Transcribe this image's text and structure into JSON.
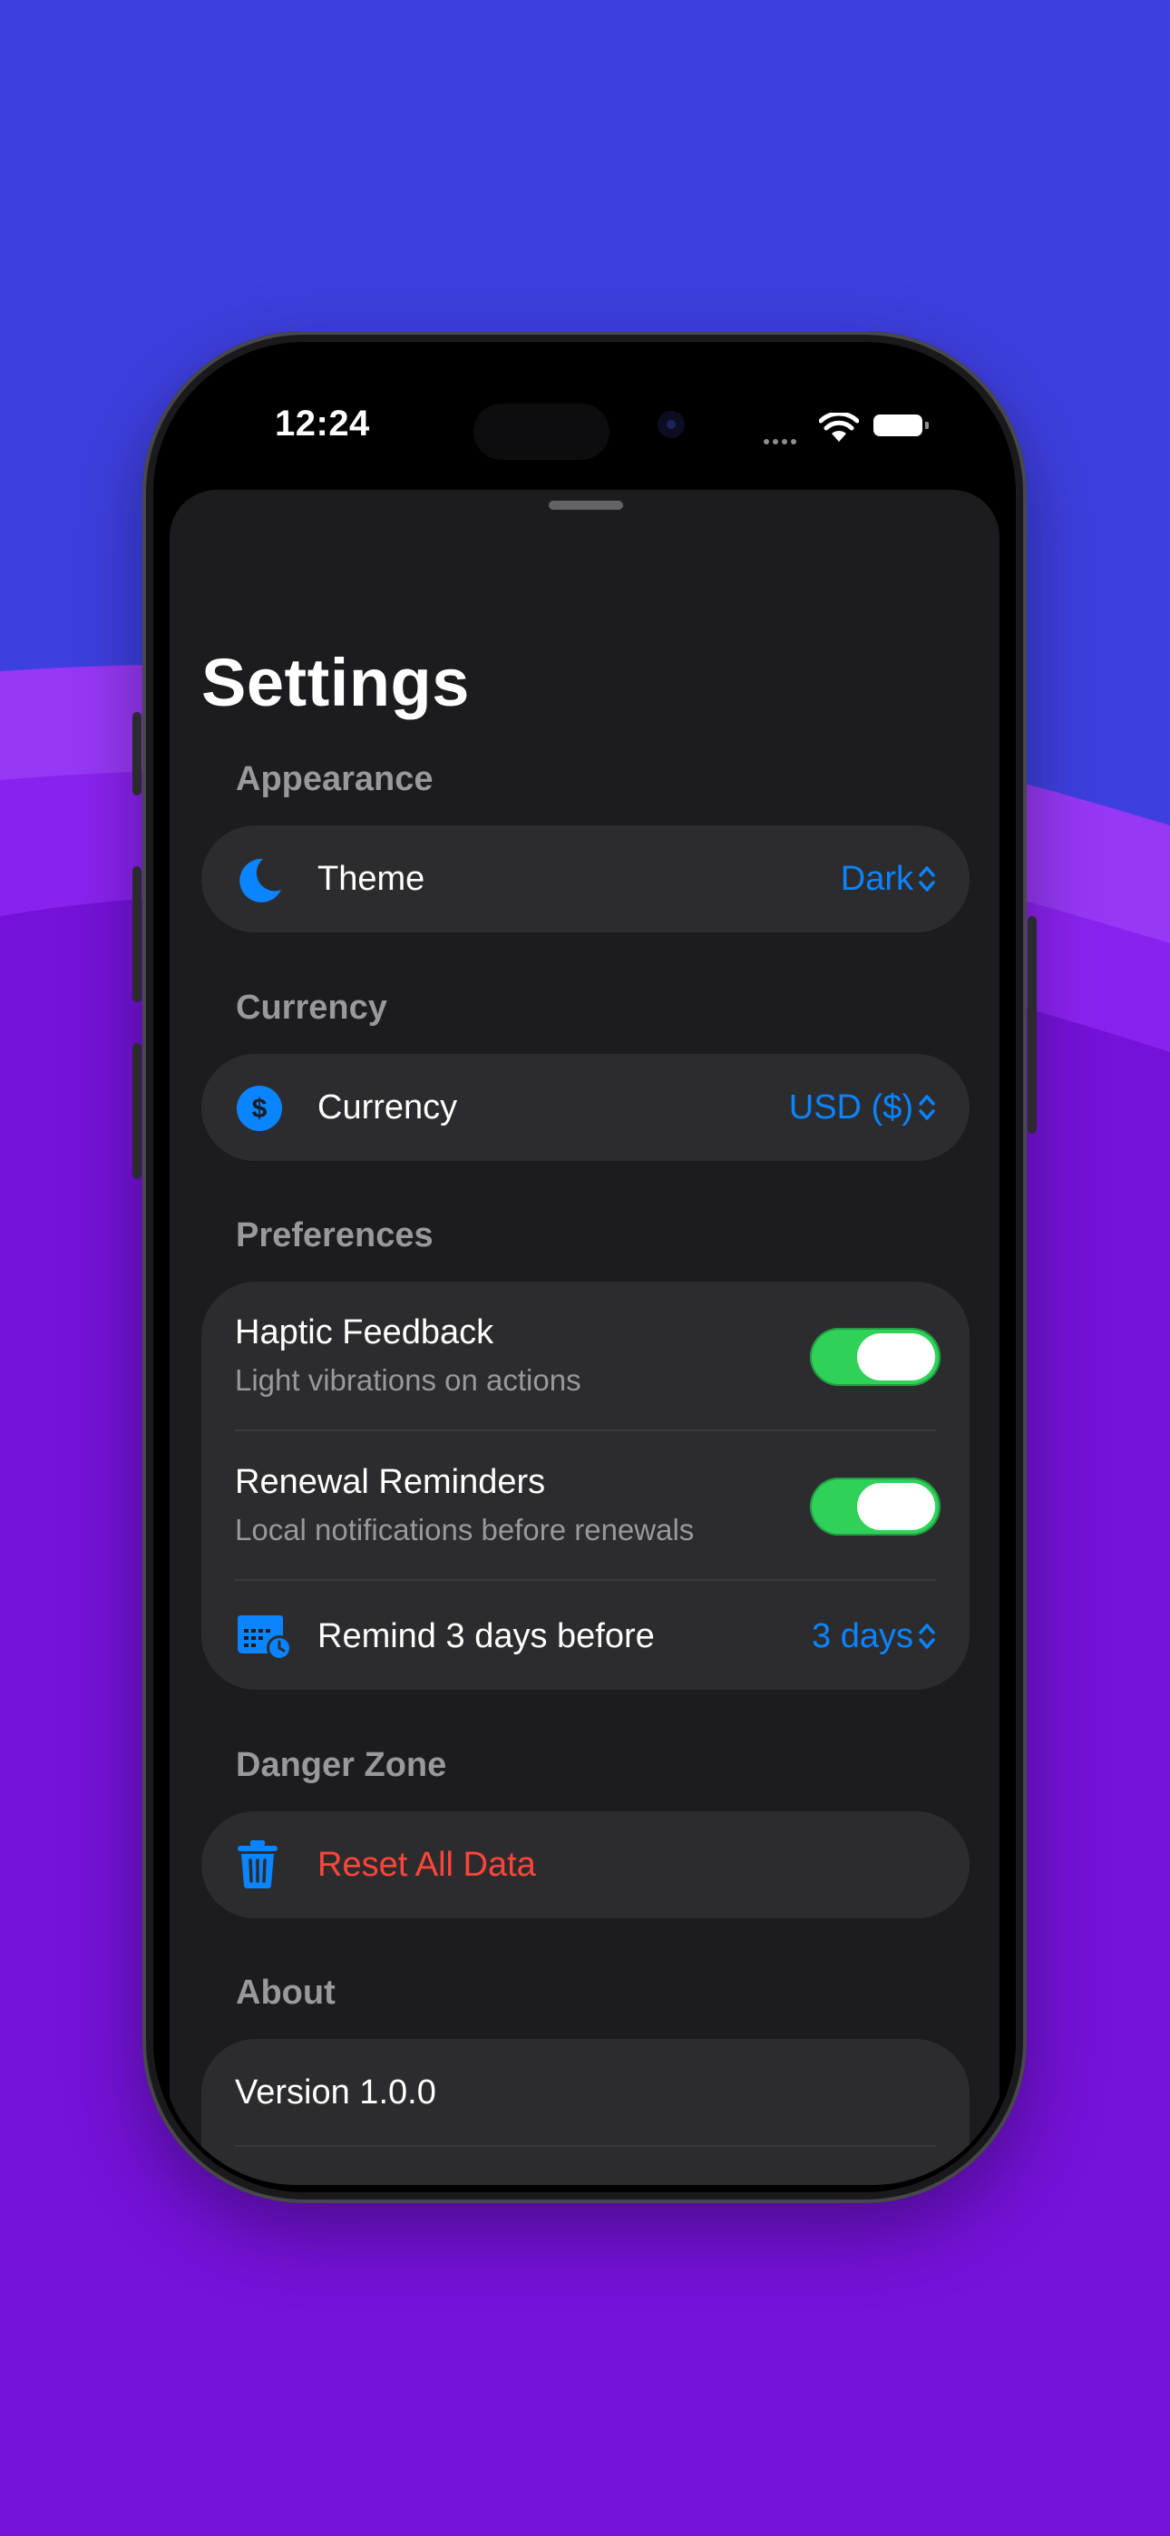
{
  "status_bar": {
    "time": "12:24"
  },
  "page": {
    "title": "Settings"
  },
  "appearance": {
    "header": "Appearance",
    "theme": {
      "label": "Theme",
      "value": "Dark",
      "icon": "moon-icon"
    }
  },
  "currency": {
    "header": "Currency",
    "currency": {
      "label": "Currency",
      "value": "USD ($)",
      "icon": "dollar-circle-icon"
    }
  },
  "preferences": {
    "header": "Preferences",
    "haptic": {
      "title": "Haptic Feedback",
      "subtitle": "Light vibrations on actions",
      "enabled": true
    },
    "reminders": {
      "title": "Renewal Reminders",
      "subtitle": "Local notifications before renewals",
      "enabled": true
    },
    "remind": {
      "label": "Remind 3 days before",
      "value": "3 days",
      "icon": "calendar-clock-icon"
    }
  },
  "danger_zone": {
    "header": "Danger Zone",
    "reset": {
      "label": "Reset All Data",
      "icon": "trash-icon"
    }
  },
  "about": {
    "header": "About",
    "version": "Version 1.0.0"
  },
  "colors": {
    "accent": "#0a84ff",
    "toggle_on": "#30d158",
    "destructive": "#ff453a",
    "background": "#3d3fdf",
    "wave": "#7412d8"
  }
}
